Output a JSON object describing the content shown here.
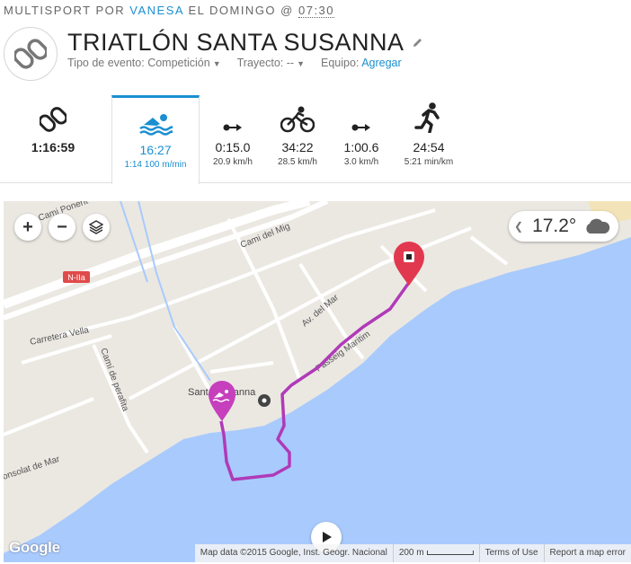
{
  "header": {
    "sport_label": "MULTISPORT POR",
    "user": "VANESA",
    "when": "EL DOMINGO @",
    "time": "07:30",
    "title": "TRIATLÓN SANTA SUSANNA",
    "event_type_label": "Tipo de evento:",
    "event_type_value": "Competición",
    "course_label": "Trayecto:",
    "course_value": "--",
    "team_label": "Equipo:",
    "team_link": "Agregar"
  },
  "summary": {
    "total": {
      "value": "1:16:59",
      "icon": "triathlon-rings-icon"
    },
    "segments": [
      {
        "icon": "swim-icon",
        "value": "16:27",
        "sub": "1:14 100 m/min",
        "active": true
      },
      {
        "icon": "transition-icon",
        "value": "0:15.0",
        "sub": "20.9 km/h"
      },
      {
        "icon": "bike-icon",
        "value": "34:22",
        "sub": "28.5 km/h"
      },
      {
        "icon": "transition-icon",
        "value": "1:00.6",
        "sub": "3.0 km/h"
      },
      {
        "icon": "run-icon",
        "value": "24:54",
        "sub": "5:21 min/km"
      }
    ]
  },
  "map": {
    "zoom_in": "+",
    "zoom_out": "−",
    "temperature": "17.2°",
    "weather_icon": "cloud-icon",
    "labels": {
      "cami_del_mig": "Cami del Mig",
      "av_del_mar": "Av. del Mar",
      "passeig_maritim": "Passeig Maritim",
      "carretera_vella": "Carretera Vella",
      "cami_de_perafita": "Camí de perafita",
      "santa_susanna": "Santa Susanna",
      "consolat_de_mar": "onsolat de Mar",
      "n_iia": "N-IIa",
      "cami_ponent": "Cami Ponent"
    },
    "google": "Google",
    "attribution": "Map data ©2015 Google, Inst. Geogr. Nacional",
    "scale": "200 m",
    "terms": "Terms of Use",
    "report": "Report a map error",
    "colors": {
      "route": "#b03ab8",
      "start_pin": "#c63fbd",
      "end_pin": "#e2384f",
      "water": "#a9cafd",
      "land": "#ebe8e2"
    }
  }
}
